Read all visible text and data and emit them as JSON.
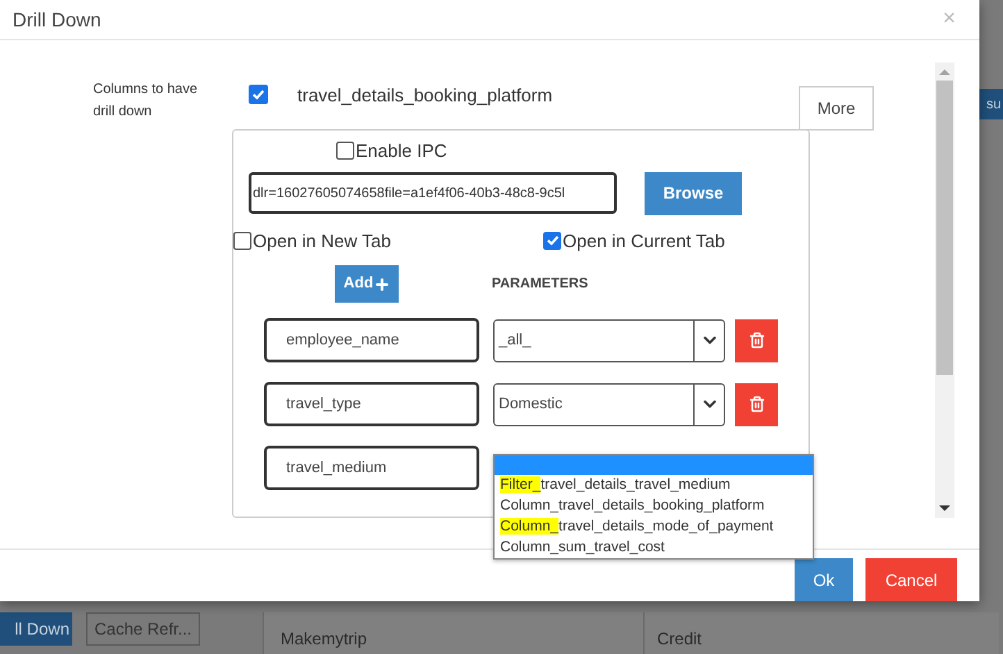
{
  "background": {
    "tab_label": "su",
    "drill_button": "ll Down",
    "cache_button": "Cache Refr...",
    "cells": [
      "Makemytrip",
      "Credit"
    ]
  },
  "dialog": {
    "title": "Drill Down",
    "close": "×",
    "columns_label": "Columns to have drill down",
    "column": {
      "checked": true,
      "name": "travel_details_booking_platform"
    },
    "more_button": "More",
    "enable_ipc": {
      "label": "Enable IPC",
      "checked": false
    },
    "url_value": "dlr=16027605074658file=a1ef4f06-40b3-48c8-9c5l",
    "browse_button": "Browse",
    "open_options": [
      {
        "label": "Open in New Tab",
        "checked": false
      },
      {
        "label": "Open in Current Tab",
        "checked": true
      }
    ],
    "add_button": "Add",
    "parameters_heading": "PARAMETERS",
    "parameters": [
      {
        "name": "employee_name",
        "value": "_all_"
      },
      {
        "name": "travel_type",
        "value": "Domestic"
      },
      {
        "name": "travel_medium"
      }
    ],
    "dropdown": {
      "options": [
        {
          "highlighted_prefix": "Filter_",
          "label": "travel_details_travel_medium"
        },
        {
          "label": "Column_travel_details_booking_platform"
        },
        {
          "highlighted_prefix": "Column_",
          "label": "travel_details_mode_of_payment"
        },
        {
          "label": "Column_sum_travel_cost"
        }
      ]
    },
    "ok_button": "Ok",
    "cancel_button": "Cancel"
  }
}
